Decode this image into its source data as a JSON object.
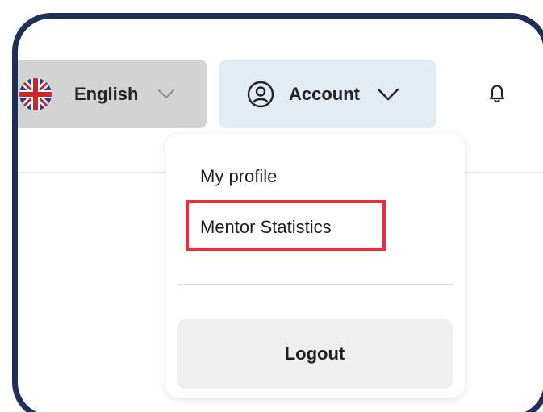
{
  "language": {
    "label": "English",
    "flag_icon": "uk-flag-icon",
    "chevron_icon": "chevron-down-icon"
  },
  "account": {
    "label": "Account",
    "user_icon": "user-circle-icon",
    "chevron_icon": "chevron-down-icon"
  },
  "notifications": {
    "icon": "bell-icon"
  },
  "dropdown": {
    "items": [
      {
        "label": "My profile"
      },
      {
        "label": "Mentor Statistics",
        "highlighted": true
      }
    ],
    "logout_label": "Logout"
  },
  "colors": {
    "frame": "#1f3056",
    "highlight": "#e8303b",
    "account_bg": "#e1ecf4",
    "language_bg": "#d3d3d3",
    "logout_bg": "#efefef"
  }
}
